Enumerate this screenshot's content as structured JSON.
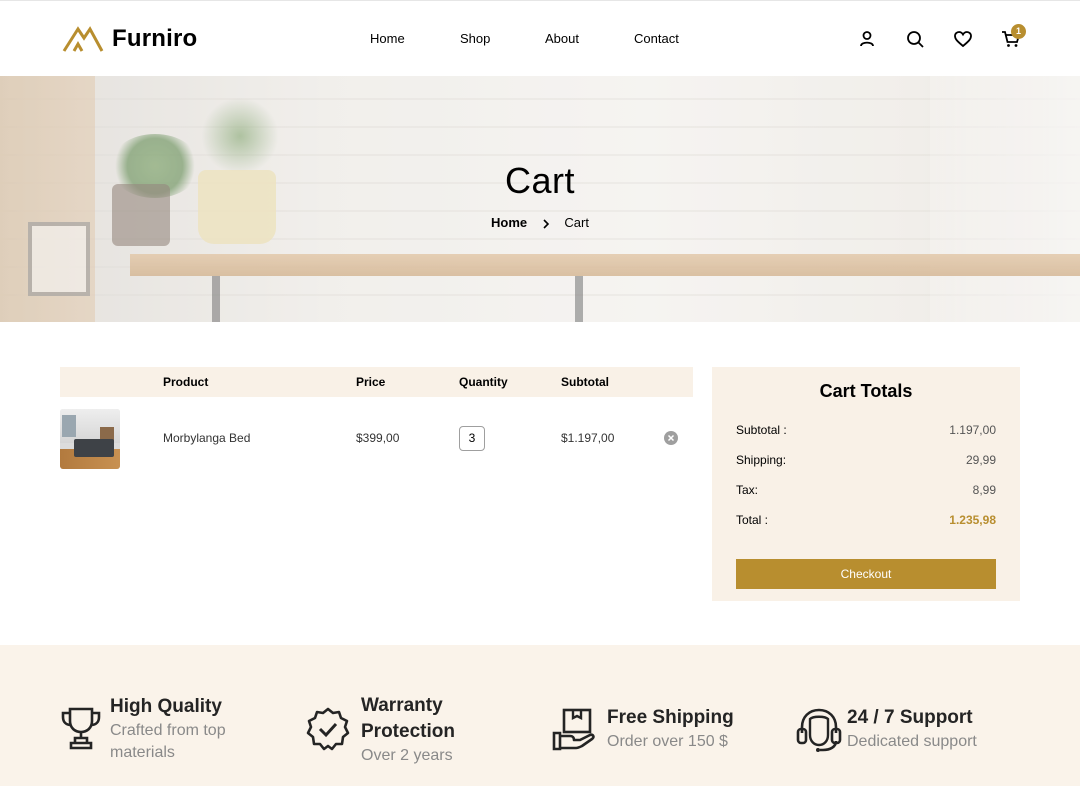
{
  "brand": {
    "name": "Furniro",
    "accent": "#B88E2F",
    "cream": "#F9F1E7"
  },
  "nav": {
    "items": [
      "Home",
      "Shop",
      "About",
      "Contact"
    ]
  },
  "header_icons": {
    "account": "user-icon",
    "search": "search-icon",
    "wishlist": "heart-icon",
    "cart": "cart-icon",
    "cart_count": "1"
  },
  "hero": {
    "title": "Cart",
    "breadcrumb_home": "Home",
    "breadcrumb_current": "Cart"
  },
  "cart_table": {
    "headers": [
      "Product",
      "Price",
      "Quantity",
      "Subtotal"
    ],
    "rows": [
      {
        "product": "Morbylanga Bed",
        "price": "$399,00",
        "quantity": "3",
        "subtotal": "$1.197,00"
      }
    ]
  },
  "totals": {
    "title": "Cart Totals",
    "subtotal_label": "Subtotal :",
    "subtotal_value": "1.197,00",
    "shipping_label": "Shipping:",
    "shipping_value": "29,99",
    "tax_label": "Tax:",
    "tax_value": "8,99",
    "total_label": "Total :",
    "total_value": "1.235,98",
    "checkout_label": "Checkout"
  },
  "features": [
    {
      "icon": "trophy-icon",
      "title": "High Quality",
      "subtitle": "Crafted from top materials"
    },
    {
      "icon": "warranty-badge-icon",
      "title": "Warranty Protection",
      "subtitle": "Over 2 years"
    },
    {
      "icon": "shipping-box-icon",
      "title": "Free Shipping",
      "subtitle": "Order over 150 $"
    },
    {
      "icon": "headset-icon",
      "title": "24 / 7 Support",
      "subtitle": "Dedicated support"
    }
  ]
}
